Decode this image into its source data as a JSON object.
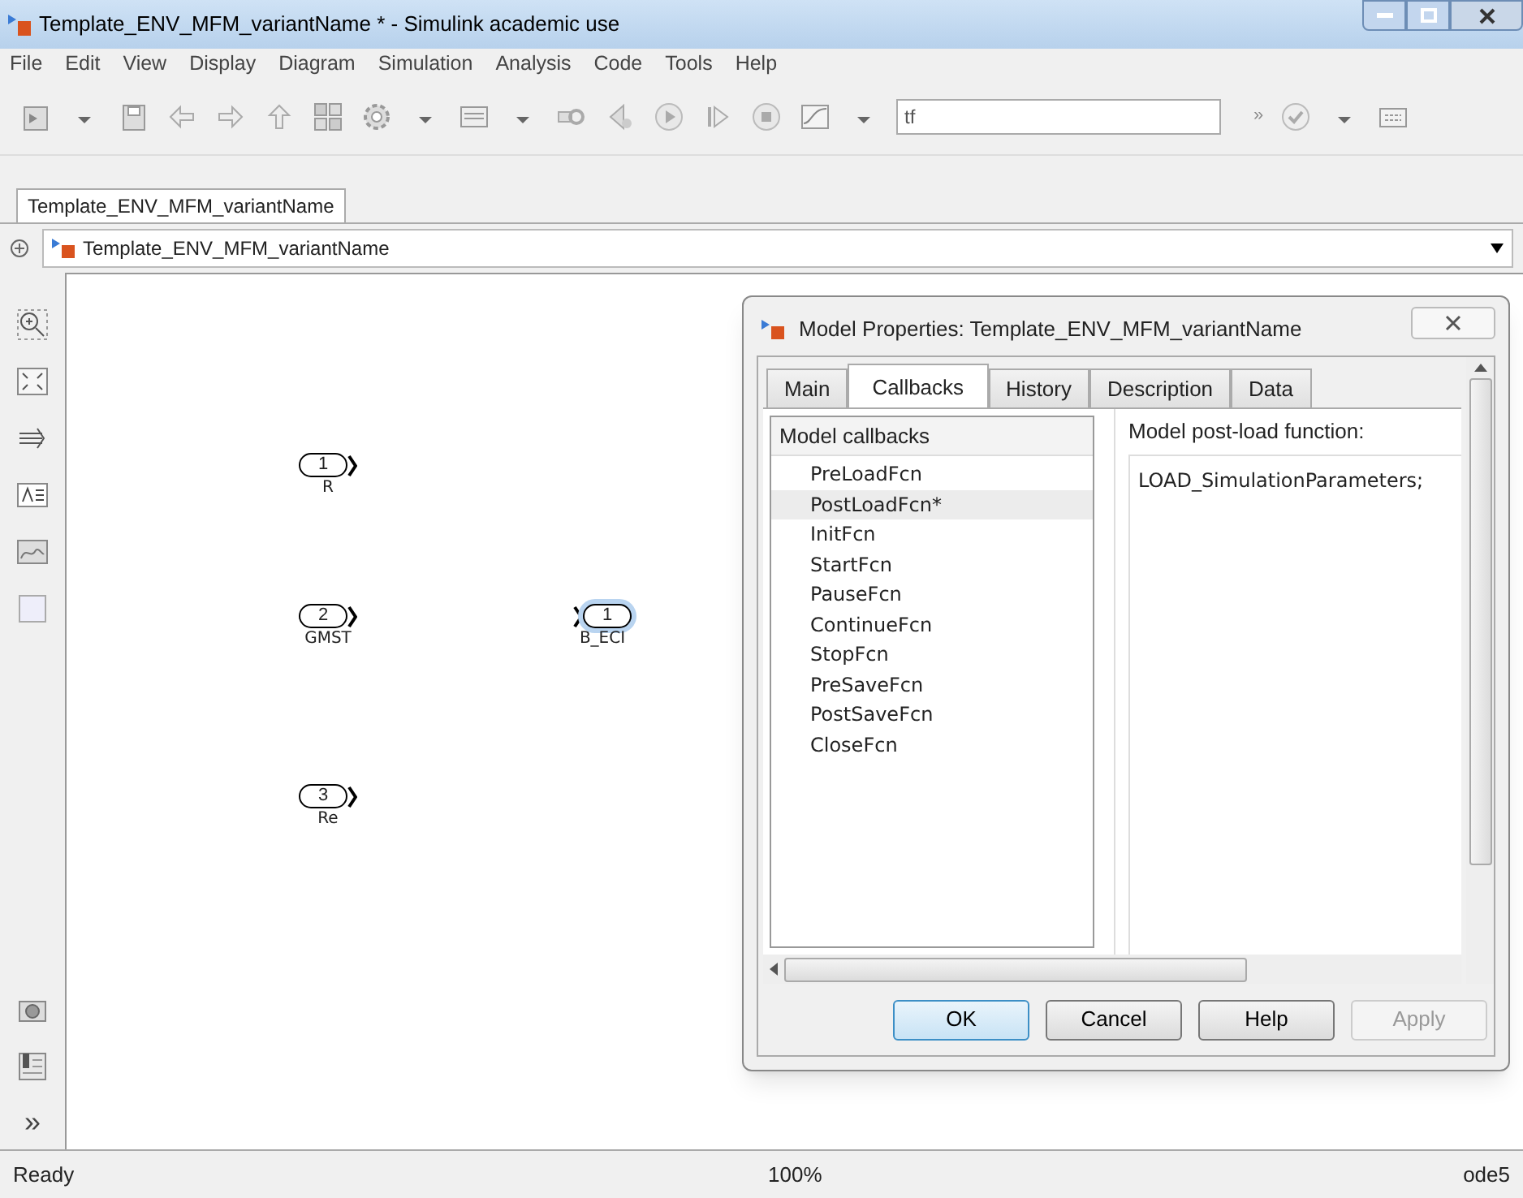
{
  "window": {
    "title": "Template_ENV_MFM_variantName * - Simulink academic use"
  },
  "menu": [
    "File",
    "Edit",
    "View",
    "Display",
    "Diagram",
    "Simulation",
    "Analysis",
    "Code",
    "Tools",
    "Help"
  ],
  "toolbar": {
    "stop_time": {
      "value": "tf"
    },
    "overflow": "»"
  },
  "model_tabs": [
    {
      "label": "Template_ENV_MFM_variantName",
      "selected": true
    }
  ],
  "breadcrumb": {
    "label": "Template_ENV_MFM_variantName"
  },
  "palette": {
    "more": "»"
  },
  "blocks": [
    {
      "kind": "inport",
      "number": "1",
      "label": "R",
      "selected": false
    },
    {
      "kind": "inport",
      "number": "2",
      "label": "GMST",
      "selected": false
    },
    {
      "kind": "inport",
      "number": "3",
      "label": "Re",
      "selected": false
    },
    {
      "kind": "outport",
      "number": "1",
      "label": "B_ECI",
      "selected": true
    }
  ],
  "dialog": {
    "title": "Model Properties: Template_ENV_MFM_variantName",
    "tabs": [
      {
        "label": "Main",
        "selected": false
      },
      {
        "label": "Callbacks",
        "selected": true
      },
      {
        "label": "History",
        "selected": false
      },
      {
        "label": "Description",
        "selected": false
      },
      {
        "label": "Data",
        "selected": false
      }
    ],
    "callbacks_header": "Model callbacks",
    "callbacks": [
      {
        "label": "PreLoadFcn",
        "selected": false
      },
      {
        "label": "PostLoadFcn*",
        "selected": true
      },
      {
        "label": "InitFcn",
        "selected": false
      },
      {
        "label": "StartFcn",
        "selected": false
      },
      {
        "label": "PauseFcn",
        "selected": false
      },
      {
        "label": "ContinueFcn",
        "selected": false
      },
      {
        "label": "StopFcn",
        "selected": false
      },
      {
        "label": "PreSaveFcn",
        "selected": false
      },
      {
        "label": "PostSaveFcn",
        "selected": false
      },
      {
        "label": "CloseFcn",
        "selected": false
      }
    ],
    "function_label": "Model post-load function:",
    "function_code": "LOAD_SimulationParameters;",
    "buttons": [
      {
        "label": "OK",
        "kind": "default",
        "disabled": false
      },
      {
        "label": "Cancel",
        "kind": "normal",
        "disabled": false
      },
      {
        "label": "Help",
        "kind": "normal",
        "disabled": false
      },
      {
        "label": "Apply",
        "kind": "normal",
        "disabled": true
      }
    ]
  },
  "status_bar": {
    "state": "Ready",
    "zoom": "100%",
    "solver": "ode5"
  }
}
